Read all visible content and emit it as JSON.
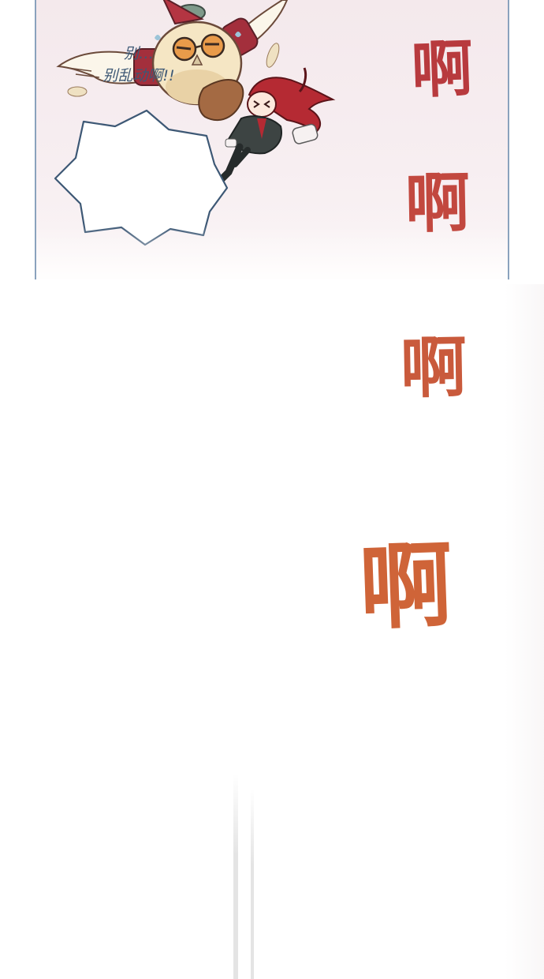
{
  "speech_bubble": {
    "line1": "别…",
    "line2": "别乱动啊!!"
  },
  "sound_effects": [
    "啊",
    "啊",
    "啊",
    "啊"
  ],
  "colors": {
    "panel_border": "#8aa2bd",
    "speech_outline": "#3d5875",
    "sfx_1": "#b83a3e",
    "sfx_4": "#cf6438"
  }
}
